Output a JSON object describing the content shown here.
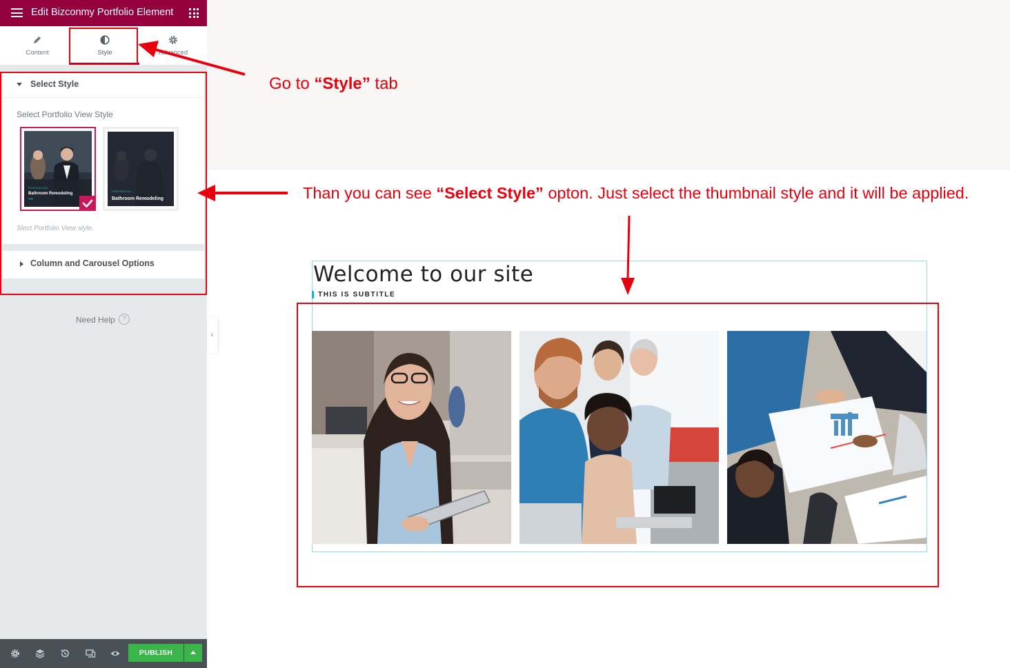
{
  "header": {
    "title": "Edit Bizconmy Portfolio Element"
  },
  "tabs": [
    {
      "label": "Content",
      "icon": "pencil-icon"
    },
    {
      "label": "Style",
      "icon": "half-circle-icon"
    },
    {
      "label": "Advanced",
      "icon": "gear-icon"
    }
  ],
  "select_style": {
    "section_title": "Select Style",
    "control_label": "Select Portfolio View Style",
    "help_text": "Slect Portfolio View style.",
    "options": [
      {
        "tag": "REMODELING",
        "caption": "Bathroom Remodeling",
        "selected": true
      },
      {
        "tag": "REMODELING",
        "caption": "Bathroom Remodeling",
        "selected": false
      }
    ]
  },
  "column_section": {
    "section_title": "Column and Carousel Options"
  },
  "need_help": {
    "label": "Need Help",
    "icon": "question-circle-icon"
  },
  "footer": {
    "icons": [
      "settings-icon",
      "layers-icon",
      "history-icon",
      "responsive-icon",
      "preview-eye-icon"
    ],
    "publish_label": "PUBLISH"
  },
  "canvas": {
    "title": "Welcome to our site",
    "subtitle": "THIS IS SUBTITLE",
    "photos": [
      "woman-with-tablet-photo",
      "team-at-computer-photo",
      "meeting-with-charts-photo"
    ]
  },
  "annotations": {
    "step1_prefix": "Go  to ",
    "step1_bold": "“Style”",
    "step1_suffix": " tab",
    "step2_prefix": "Than you  can see ",
    "step2_bold": "“Select Style”",
    "step2_suffix": " opton. Just select the thumbnail style and it will be applied."
  },
  "colors": {
    "header": "#93003c",
    "accent": "#c71a5c",
    "publish": "#39b54a",
    "annotation_red": "#e8000d",
    "subtitle_accent": "#17b3c7"
  }
}
